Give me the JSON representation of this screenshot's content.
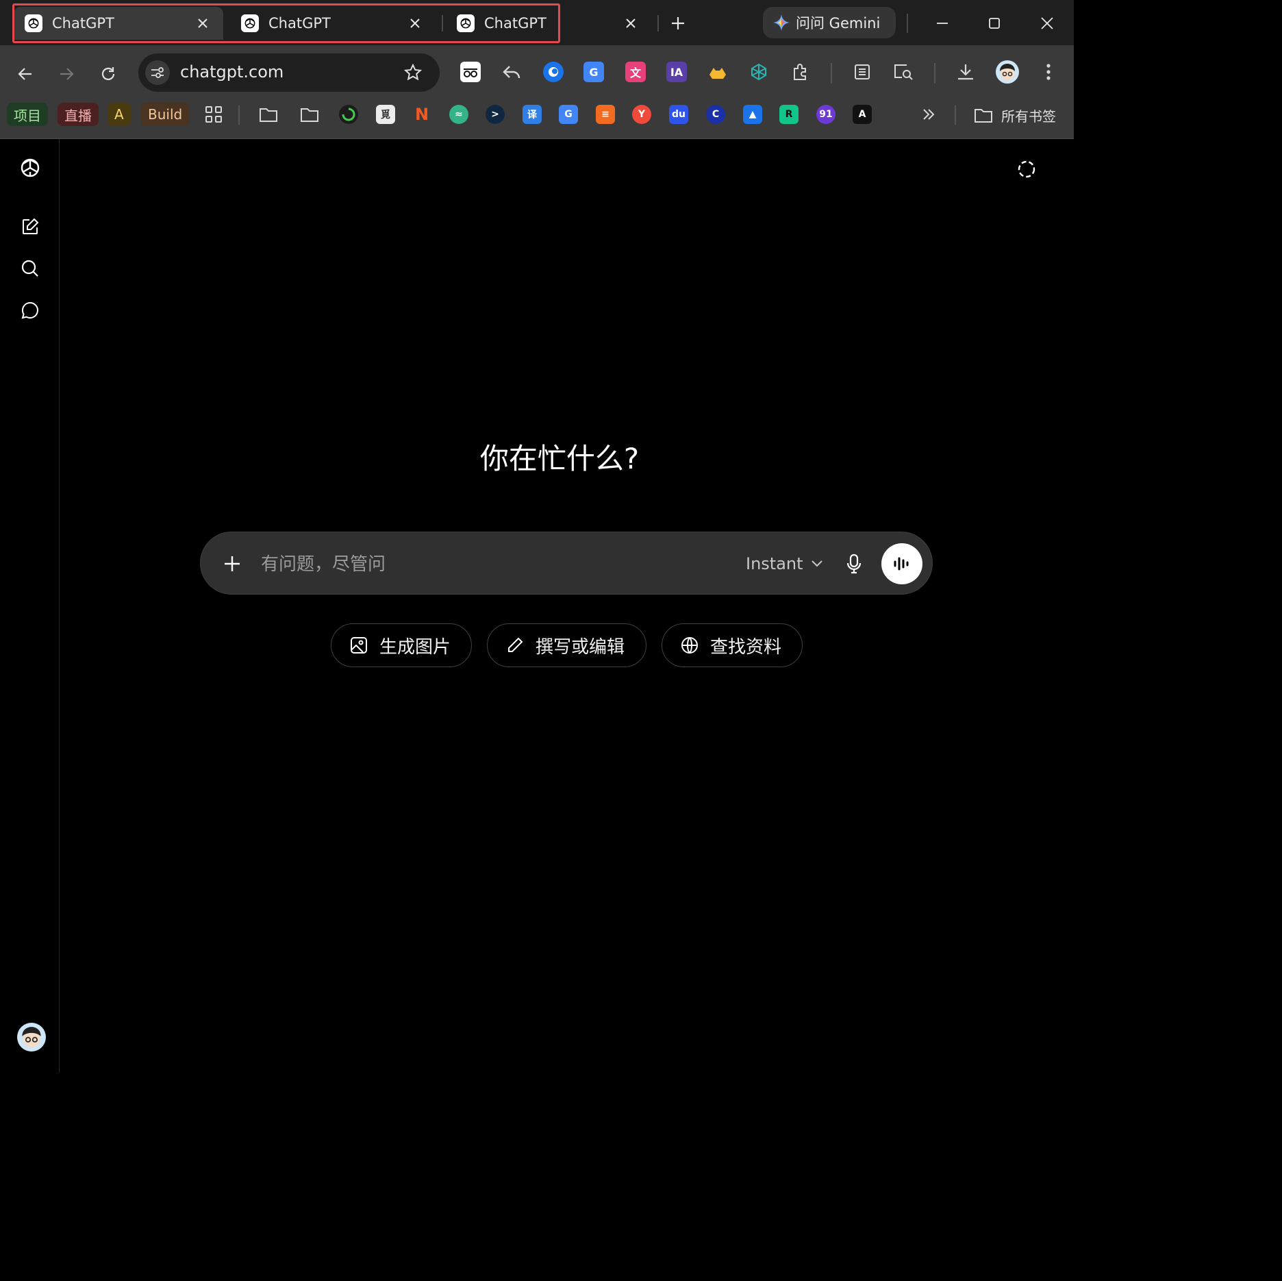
{
  "tabs": [
    {
      "title": "ChatGPT",
      "active": true
    },
    {
      "title": "ChatGPT",
      "active": false
    },
    {
      "title": "ChatGPT",
      "active": false
    }
  ],
  "gemini": {
    "label": "问问 Gemini"
  },
  "omnibox": {
    "url": "chatgpt.com"
  },
  "bookmarks": {
    "items": [
      {
        "label": "项目",
        "color": "#1f3d24",
        "text_color": "#a6e3a1"
      },
      {
        "label": "直播",
        "color": "#4a2020",
        "text_color": "#f4b0b0"
      },
      {
        "label": "A",
        "color": "#4a3a10",
        "text_color": "#f5d76e"
      },
      {
        "label": "Build",
        "color": "#4a3320",
        "text_color": "#f2c89b"
      }
    ],
    "all_label": "所有书签"
  },
  "main": {
    "headline": "你在忙什么?",
    "composer": {
      "placeholder": "有问题，尽管问",
      "model": "Instant"
    },
    "chips": [
      {
        "label": "生成图片",
        "icon": "image-icon"
      },
      {
        "label": "撰写或编辑",
        "icon": "pencil-icon"
      },
      {
        "label": "查找资料",
        "icon": "globe-icon"
      }
    ]
  },
  "colors": {
    "highlight": "#e5484d",
    "background": "#000000",
    "composer": "#303030"
  }
}
